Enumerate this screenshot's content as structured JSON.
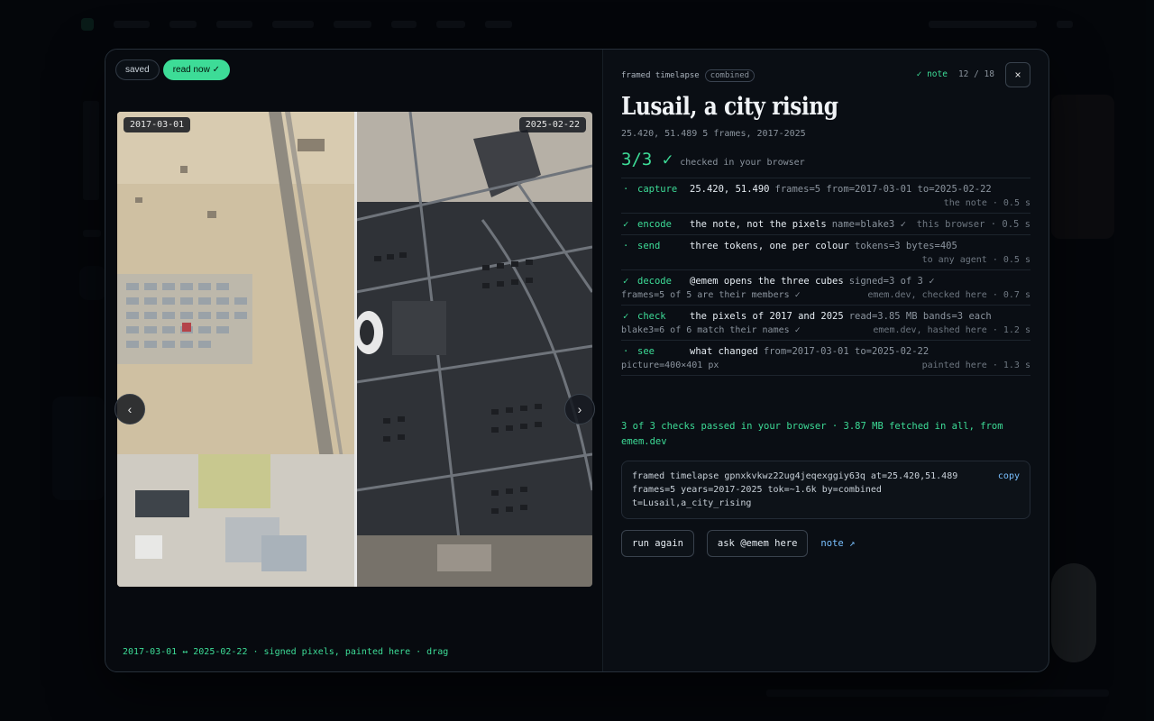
{
  "chips": [
    {
      "label": "saved",
      "active": false
    },
    {
      "label": "read now ✓",
      "active": true
    }
  ],
  "viewer": {
    "left_date": "2017-03-01",
    "right_date": "2025-02-22",
    "prev_icon": "chevron-left-icon",
    "next_icon": "chevron-right-icon",
    "prev_glyph": "‹",
    "next_glyph": "›",
    "caption": "2017-03-01 ↔ 2025-02-22 · signed pixels, painted here · drag"
  },
  "header": {
    "kind": "framed timelapse",
    "badge": "combined",
    "note_status": "✓ note",
    "counter": "12 / 18",
    "close_glyph": "×"
  },
  "title": "Lusail, a city rising",
  "subtitle": "25.420, 51.489  5 frames, 2017-2025",
  "score": {
    "value": "3/3 ✓",
    "label": "checked in your browser"
  },
  "steps": [
    {
      "mark": "·",
      "name": "capture",
      "desc": "25.420, 51.490",
      "kv": "frames=5  from=2017-03-01  to=2025-02-22",
      "detail": "",
      "where": "the note · 0.5 s"
    },
    {
      "mark": "✓",
      "name": "encode",
      "desc": "the note, not the pixels",
      "kv": "name=blake3 ✓",
      "detail": "",
      "where": "this browser · 0.5 s",
      "inline": true
    },
    {
      "mark": "·",
      "name": "send",
      "desc": "three tokens, one per colour",
      "kv": "tokens=3  bytes=405",
      "detail": "",
      "where": "to any agent · 0.5 s"
    },
    {
      "mark": "✓",
      "name": "decode",
      "desc": "@emem opens the three cubes",
      "kv": "signed=3 of 3 ✓",
      "detail": "frames=5 of 5 are their members ✓",
      "where": "emem.dev, checked here · 0.7 s"
    },
    {
      "mark": "✓",
      "name": "check",
      "desc": "the pixels of 2017 and 2025",
      "kv": "read=3.85 MB  bands=3 each",
      "detail": "blake3=6 of 6 match their names ✓",
      "where": "emem.dev, hashed here · 1.2 s"
    },
    {
      "mark": "·",
      "name": "see",
      "desc": "what changed",
      "kv": "from=2017-03-01  to=2025-02-22",
      "detail": "picture=400×401 px",
      "where": "painted here · 1.3 s"
    }
  ],
  "summary": "3 of 3 checks passed in your browser · 3.87 MB fetched in all, from emem.dev",
  "code": {
    "lines": [
      "framed timelapse gpnxkvkwz22ug4jeqexggiy63q at=25.420,51.489",
      "frames=5 years=2017-2025 tok=~1.6k by=combined",
      "t=Lusail,a_city_rising"
    ],
    "copy_label": "copy"
  },
  "actions": {
    "run_again": "run again",
    "ask": "ask @emem here",
    "note_link": "note ↗"
  },
  "colors": {
    "accent": "#3ddc97",
    "link": "#79c0ff",
    "panel": "#0a0e14"
  }
}
